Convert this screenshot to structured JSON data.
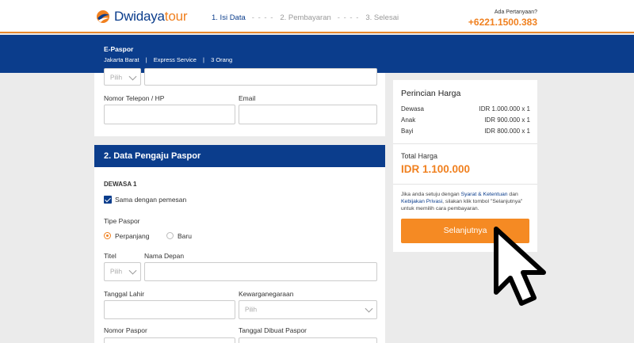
{
  "header": {
    "logo_left": "Dwidaya",
    "logo_right": "tour",
    "steps": [
      {
        "label": "1. Isi Data"
      },
      {
        "label": "2. Pembayaran"
      },
      {
        "label": "3. Selesai"
      }
    ],
    "step_separator": "- - - -",
    "help_question": "Ada Pertanyaan?",
    "help_phone": "+6221.1500.383"
  },
  "banner": {
    "title": "E-Paspor",
    "location": "Jakarta Barat",
    "service": "Express Service",
    "people": "3 Orang",
    "separator": "|"
  },
  "form_top": {
    "title_select": "Pilih",
    "phone_label": "Nomor Telepon / HP",
    "email_label": "Email"
  },
  "applicant": {
    "section_title": "2. Data Pengaju Paspor",
    "adult_heading": "DEWASA 1",
    "same_as_orderer": "Sama dengan pemesan",
    "type_label": "Tipe Paspor",
    "type_options": [
      "Perpanjang",
      "Baru"
    ],
    "title_label": "Titel",
    "title_placeholder": "Pilih",
    "first_name_label": "Nama Depan",
    "birth_date_label": "Tanggal Lahir",
    "nationality_label": "Kewarganegaraan",
    "nationality_placeholder": "Pilih",
    "passport_number_label": "Nomor Paspor",
    "issue_date_label": "Tanggal Dibuat Paspor"
  },
  "price": {
    "title": "Perincian Harga",
    "rows": [
      {
        "name": "Dewasa",
        "value": "IDR 1.000.000  x 1"
      },
      {
        "name": "Anak",
        "value": "IDR 900.000  x 1"
      },
      {
        "name": "Bayi",
        "value": "IDR 800.000  x 1"
      }
    ],
    "total_label": "Total Harga",
    "total_value": "IDR 1.100.000",
    "terms_pre": "Jika anda setuju dengan ",
    "terms_link1": "Syarat & Ketentuan",
    "terms_mid": " dan ",
    "terms_link2": "Kebijakan Privasi",
    "terms_post": ", silakan klik tombol \"Selanjutnya\" untuk memilih cara pembayaran.",
    "next_button": "Selanjutnya"
  },
  "colors": {
    "brand_blue": "#0b3d8c",
    "accent_orange": "#f58a23"
  }
}
